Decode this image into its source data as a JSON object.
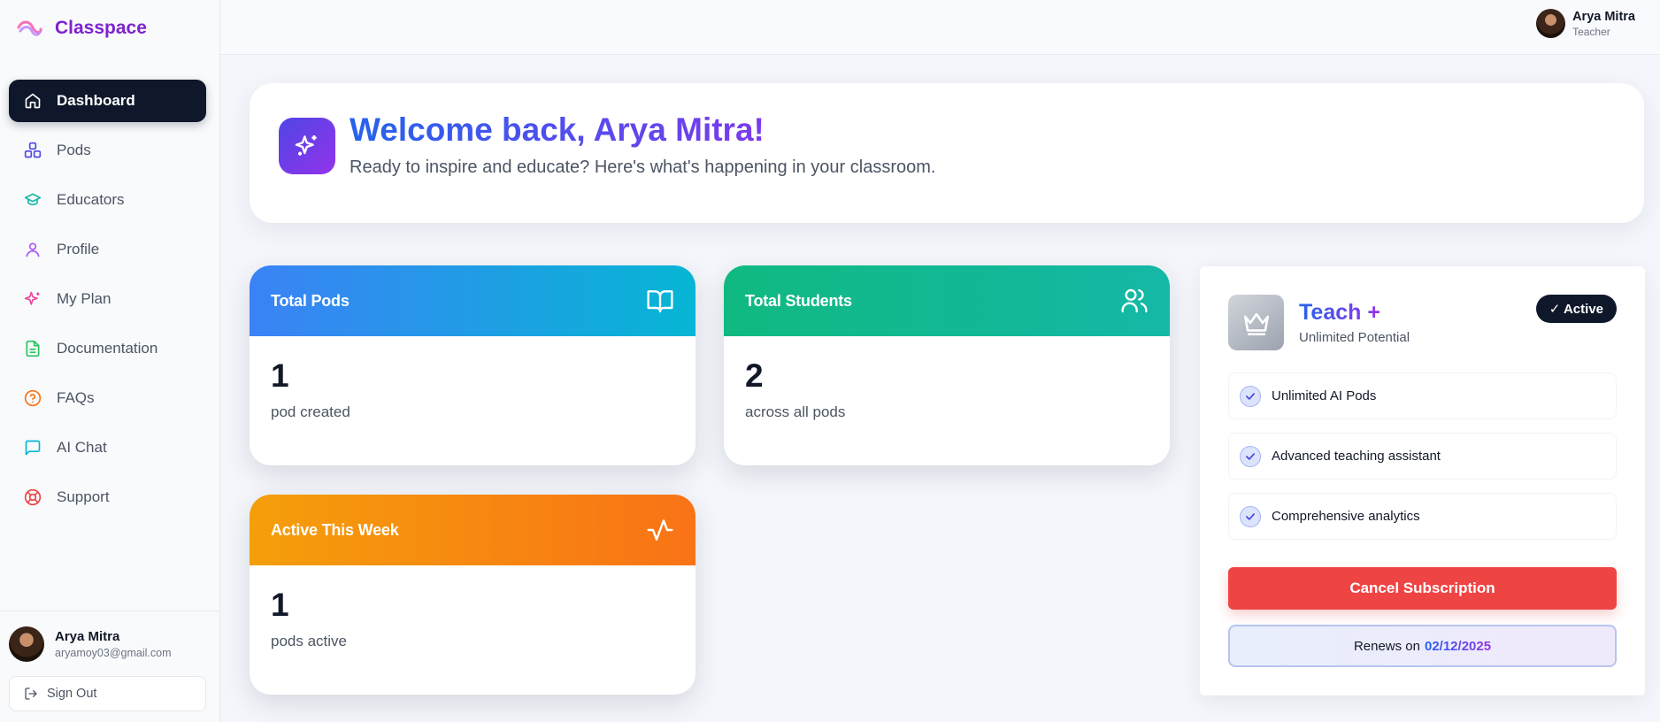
{
  "app": {
    "name": "Classpace"
  },
  "sidebar": {
    "items": [
      {
        "label": "Dashboard",
        "icon": "home-icon",
        "active": true
      },
      {
        "label": "Pods",
        "icon": "boxes-icon",
        "color": "#4f46e5"
      },
      {
        "label": "Educators",
        "icon": "graduation-cap-icon",
        "color": "#14b8a6"
      },
      {
        "label": "Profile",
        "icon": "user-icon",
        "color": "#a855f7"
      },
      {
        "label": "My Plan",
        "icon": "sparkles-icon",
        "color": "#ec4899"
      },
      {
        "label": "Documentation",
        "icon": "file-text-icon",
        "color": "#22c55e"
      },
      {
        "label": "FAQs",
        "icon": "help-circle-icon",
        "color": "#f97316"
      },
      {
        "label": "AI Chat",
        "icon": "message-square-icon",
        "color": "#06b6d4"
      },
      {
        "label": "Support",
        "icon": "life-buoy-icon",
        "color": "#ef4444"
      }
    ],
    "user": {
      "name": "Arya Mitra",
      "email": "aryamoy03@gmail.com"
    },
    "sign_out_label": "Sign Out"
  },
  "topbar": {
    "user_name": "Arya Mitra",
    "user_role": "Teacher"
  },
  "welcome": {
    "title": "Welcome back, Arya Mitra!",
    "subtitle": "Ready to inspire and educate? Here's what's happening in your classroom."
  },
  "stats": [
    {
      "title": "Total Pods",
      "value": "1",
      "description": "pod created",
      "icon": "book-open-icon"
    },
    {
      "title": "Total Students",
      "value": "2",
      "description": "across all pods",
      "icon": "users-icon"
    },
    {
      "title": "Active This Week",
      "value": "1",
      "description": "pods active",
      "icon": "activity-icon"
    }
  ],
  "plan": {
    "name": "Teach +",
    "tagline": "Unlimited Potential",
    "badge": "✓ Active",
    "features": [
      "Unlimited AI Pods",
      "Advanced teaching assistant",
      "Comprehensive analytics"
    ],
    "cancel_label": "Cancel Subscription",
    "renews_label": "Renews on",
    "renews_date": "02/12/2025",
    "icon": "crown-icon"
  },
  "colors": {
    "accent_blue": "#2563eb",
    "accent_purple": "#7c3aed",
    "danger": "#ef4444",
    "nav_active_bg": "#0f172a"
  }
}
